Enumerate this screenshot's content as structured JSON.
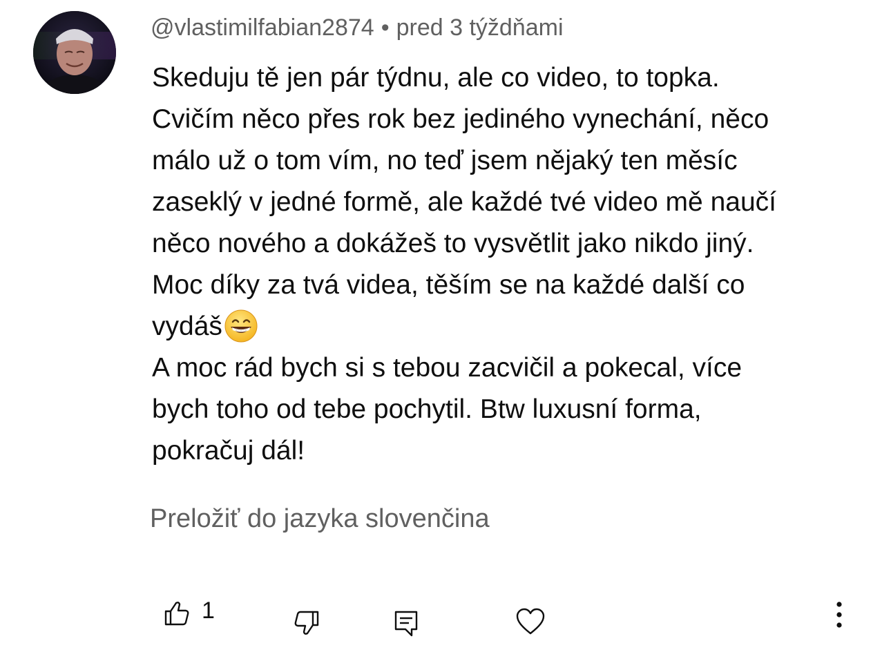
{
  "comment": {
    "author": "@vlastimilfabian2874",
    "separator": "•",
    "timestamp": "pred 3 týždňami",
    "avatar_icon": "user-avatar-photo",
    "body_lines": [
      "Skeduju tě jen pár týdnu, ale co video, to topka.",
      "Cvičím něco přes rok bez jediného vynechání, něco",
      "málo už o tom vím, no teď jsem nějaký ten měsíc",
      "zaseklý v jedné formě, ale každé tvé video mě naučí",
      "něco nového a dokážeš to vysvětlit jako nikdo jiný.",
      "Moc díky za tvá videa, těším se na každé další co",
      "vydáš",
      "A moc rád bych si s tebou zacvičil a pokecal, více",
      "bych toho od tebe pochytil. Btw luxusní forma,",
      "pokračuj dál!"
    ],
    "emoji": "grinning-face-with-smiling-eyes",
    "translate_label": "Preložiť do jazyka slovenčina",
    "actions": {
      "like_count": "1",
      "like_icon": "thumbs-up-icon",
      "dislike_icon": "thumbs-down-icon",
      "reply_icon": "reply-comment-icon",
      "heart_icon": "heart-icon",
      "more_icon": "more-vertical-icon"
    }
  },
  "colors": {
    "text_primary": "#0f0f0f",
    "text_secondary": "#606060",
    "background": "#ffffff"
  }
}
